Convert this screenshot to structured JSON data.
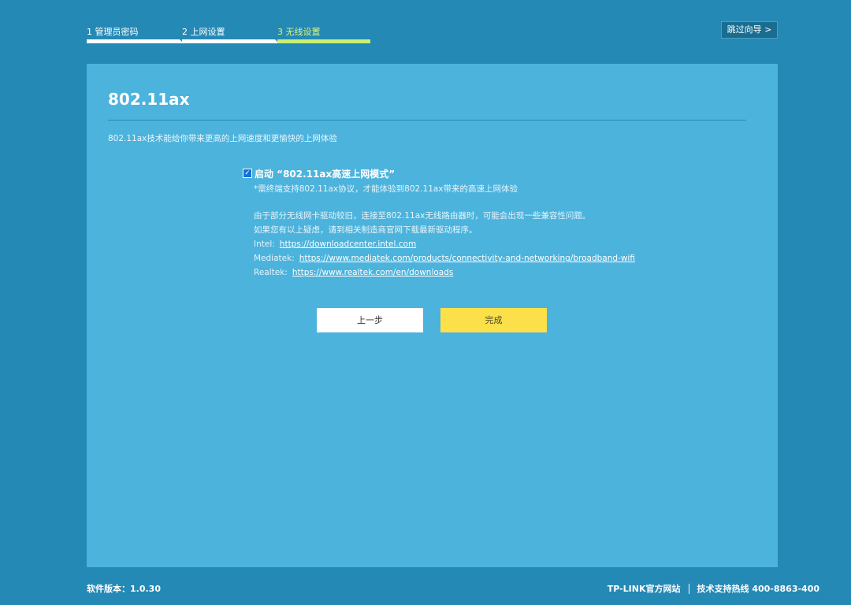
{
  "steps": [
    {
      "label": "1 管理员密码",
      "state": "done"
    },
    {
      "label": "2 上网设置",
      "state": "done"
    },
    {
      "label": "3 无线设置",
      "state": "active"
    }
  ],
  "skip_label": "跳过向导 >",
  "panel": {
    "title": "802.11ax",
    "description": "802.11ax技术能给你带来更高的上网速度和更愉快的上网体验",
    "option": {
      "checked": true,
      "label": "启动  “802.11ax高速上网模式”",
      "note": "*需终端支持802.11ax协议，才能体验到802.11ax带来的高速上网体验"
    },
    "info_lines": [
      "由于部分无线网卡驱动较旧，连接至802.11ax无线路由器时，可能会出现一些兼容性问题。",
      "如果您有以上疑虑，请到相关制造商官网下载最新驱动程序。"
    ],
    "vendors": [
      {
        "name": "Intel:",
        "url": "https://downloadcenter.intel.com"
      },
      {
        "name": "Mediatek:",
        "url": "https://www.mediatek.com/products/connectivity-and-networking/broadband-wifi"
      },
      {
        "name": "Realtek:",
        "url": "https://www.realtek.com/en/downloads"
      }
    ],
    "prev_label": "上一步",
    "done_label": "完成"
  },
  "footer": {
    "version": "软件版本：1.0.30",
    "official_site": "TP-LINK官方网站",
    "support_hotline": "技术支持热线 400-8863-400"
  },
  "colors": {
    "background": "#2589b5",
    "panel": "#4cb3dc",
    "active_step": "#c9ef73",
    "primary_button": "#fbe04a"
  }
}
